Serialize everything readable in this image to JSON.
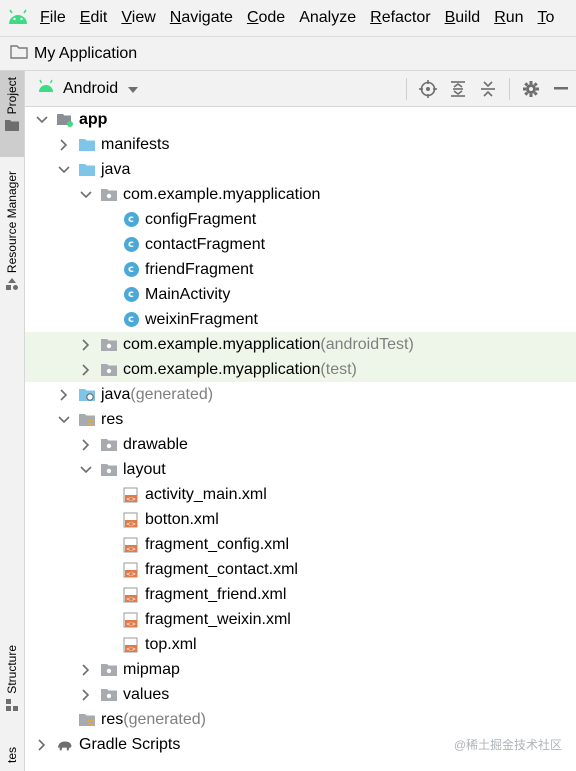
{
  "menu": {
    "items": [
      {
        "underline": "F",
        "rest": "ile"
      },
      {
        "underline": "E",
        "rest": "dit"
      },
      {
        "underline": "V",
        "rest": "iew"
      },
      {
        "underline": "N",
        "rest": "avigate"
      },
      {
        "underline": "C",
        "rest": "ode"
      },
      {
        "underline": "",
        "rest": "Analyze"
      },
      {
        "underline": "R",
        "rest": "efactor"
      },
      {
        "underline": "B",
        "rest": "uild"
      },
      {
        "underline": "R",
        "rest": "un"
      },
      {
        "underline": "T",
        "rest": "o"
      }
    ]
  },
  "window": {
    "title": "My Application"
  },
  "stripe": {
    "project": "Project",
    "resource_manager": "Resource Manager",
    "structure": "Structure",
    "favorites_fragment": "tes"
  },
  "toolbar": {
    "view_label": "Android"
  },
  "colors": {
    "android_green": "#3ddc84",
    "folder_blue": "#7fc5e8",
    "class_blue": "#4aa9d8",
    "highlight_row": "#eef6e9",
    "muted_text": "#7f7f7f"
  },
  "tree": [
    {
      "label": "app",
      "bold": true,
      "suffix": "",
      "icon": "module-icon",
      "chevron": "down",
      "indent": 0
    },
    {
      "label": "manifests",
      "suffix": "",
      "icon": "folder-blue-icon",
      "chevron": "right",
      "indent": 1
    },
    {
      "label": "java",
      "suffix": "",
      "icon": "folder-blue-icon",
      "chevron": "down",
      "indent": 1
    },
    {
      "label": "com.example.myapplication",
      "suffix": "",
      "icon": "package-icon",
      "chevron": "down",
      "indent": 2
    },
    {
      "label": "configFragment",
      "suffix": "",
      "icon": "class-icon",
      "chevron": "",
      "indent": 3
    },
    {
      "label": "contactFragment",
      "suffix": "",
      "icon": "class-icon",
      "chevron": "",
      "indent": 3
    },
    {
      "label": "friendFragment",
      "suffix": "",
      "icon": "class-icon",
      "chevron": "",
      "indent": 3
    },
    {
      "label": "MainActivity",
      "suffix": "",
      "icon": "class-icon",
      "chevron": "",
      "indent": 3
    },
    {
      "label": "weixinFragment",
      "suffix": "",
      "icon": "class-icon",
      "chevron": "",
      "indent": 3
    },
    {
      "label": "com.example.myapplication",
      "suffix": " (androidTest)",
      "icon": "package-icon",
      "chevron": "right",
      "indent": 2,
      "highlight": true
    },
    {
      "label": "com.example.myapplication",
      "suffix": " (test)",
      "icon": "package-icon",
      "chevron": "right",
      "indent": 2,
      "highlight": true
    },
    {
      "label": "java",
      "suffix": " (generated)",
      "icon": "generated-folder-icon",
      "chevron": "right",
      "indent": 1
    },
    {
      "label": "res",
      "suffix": "",
      "icon": "res-folder-icon",
      "chevron": "down",
      "indent": 1
    },
    {
      "label": "drawable",
      "suffix": "",
      "icon": "package-icon",
      "chevron": "right",
      "indent": 2
    },
    {
      "label": "layout",
      "suffix": "",
      "icon": "package-icon",
      "chevron": "down",
      "indent": 2
    },
    {
      "label": "activity_main.xml",
      "suffix": "",
      "icon": "layout-xml-icon",
      "chevron": "",
      "indent": 3
    },
    {
      "label": "botton.xml",
      "suffix": "",
      "icon": "layout-xml-icon",
      "chevron": "",
      "indent": 3
    },
    {
      "label": "fragment_config.xml",
      "suffix": "",
      "icon": "layout-xml-icon",
      "chevron": "",
      "indent": 3
    },
    {
      "label": "fragment_contact.xml",
      "suffix": "",
      "icon": "layout-xml-icon",
      "chevron": "",
      "indent": 3
    },
    {
      "label": "fragment_friend.xml",
      "suffix": "",
      "icon": "layout-xml-icon",
      "chevron": "",
      "indent": 3
    },
    {
      "label": "fragment_weixin.xml",
      "suffix": "",
      "icon": "layout-xml-icon",
      "chevron": "",
      "indent": 3
    },
    {
      "label": "top.xml",
      "suffix": "",
      "icon": "layout-xml-icon",
      "chevron": "",
      "indent": 3
    },
    {
      "label": "mipmap",
      "suffix": "",
      "icon": "package-icon",
      "chevron": "right",
      "indent": 2
    },
    {
      "label": "values",
      "suffix": "",
      "icon": "package-icon",
      "chevron": "right",
      "indent": 2
    },
    {
      "label": "res",
      "suffix": " (generated)",
      "icon": "res-folder-icon",
      "chevron": "",
      "indent": 1
    },
    {
      "label": "Gradle Scripts",
      "suffix": "",
      "icon": "gradle-icon",
      "chevron": "right",
      "indent": 0
    }
  ],
  "watermark": "@稀土掘金技术社区"
}
